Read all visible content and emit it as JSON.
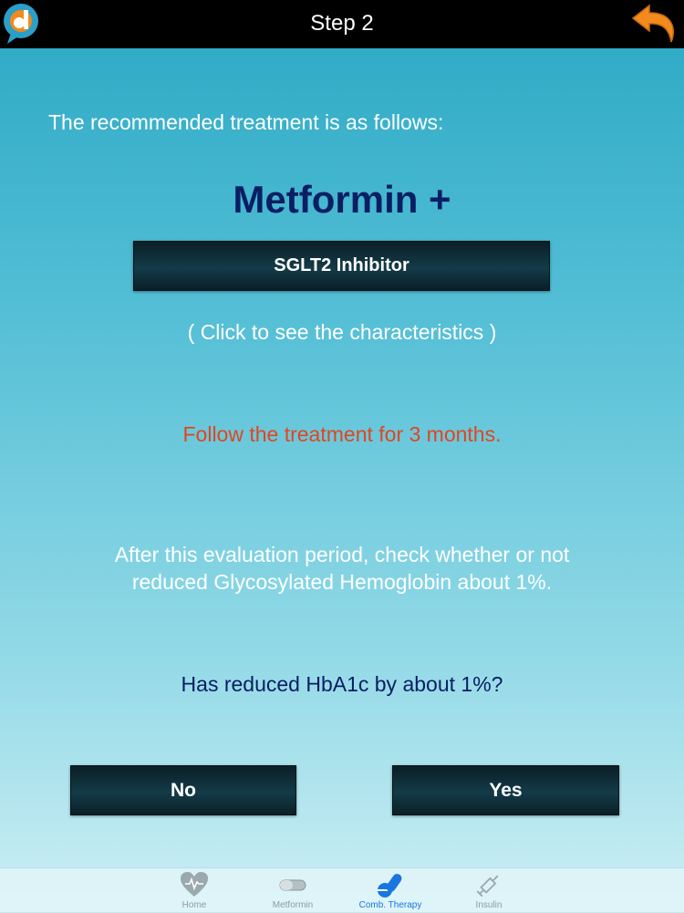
{
  "header": {
    "title": "Step 2"
  },
  "content": {
    "intro": "The recommended treatment is as follows:",
    "drug": "Metformin +",
    "inhibitor_button": "SGLT2 Inhibitor",
    "hint": "( Click to see the characteristics )",
    "follow": "Follow the treatment for 3 months.",
    "evaluation_line1": "After this evaluation period, check whether or not",
    "evaluation_line2": "reduced Glycosylated Hemoglobin about 1%.",
    "question": "Has reduced HbA1c by about 1%?",
    "no_label": "No",
    "yes_label": "Yes"
  },
  "tabs": [
    {
      "label": "Home",
      "icon": "heart-icon"
    },
    {
      "label": "Metformin",
      "icon": "pill-icon"
    },
    {
      "label": "Comb. Therapy",
      "icon": "pills-icon",
      "active": true
    },
    {
      "label": "Insulin",
      "icon": "syringe-icon"
    }
  ],
  "colors": {
    "accent_orange": "#f28a1e",
    "follow_text": "#e2451e",
    "heading_navy": "#0a1e63",
    "active_tab": "#1976e0"
  }
}
